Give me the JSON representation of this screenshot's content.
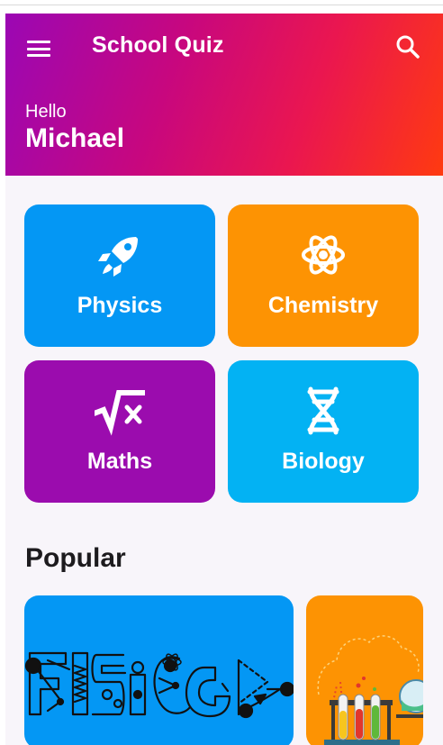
{
  "header": {
    "title": "School Quiz",
    "greeting": "Hello",
    "user_name": "Michael",
    "icons": {
      "menu": "menu-icon",
      "search": "search-icon"
    }
  },
  "subjects": [
    {
      "label": "Physics",
      "icon": "rocket-icon",
      "color": "#0497f4"
    },
    {
      "label": "Chemistry",
      "icon": "atom-icon",
      "color": "#fd9303"
    },
    {
      "label": "Maths",
      "icon": "square-root-icon",
      "color": "#9b0cae"
    },
    {
      "label": "Biology",
      "icon": "dna-icon",
      "color": "#03b2f3"
    }
  ],
  "popular": {
    "title": "Popular",
    "cards": [
      {
        "name": "physics-card",
        "color": "#0497f4"
      },
      {
        "name": "chemistry-card",
        "color": "#fd9303"
      }
    ]
  },
  "colors": {
    "header_gradient": [
      "#9b07b4",
      "#c8077e",
      "#ea1650",
      "#ff3a10"
    ],
    "background": "#f8f5fa"
  }
}
